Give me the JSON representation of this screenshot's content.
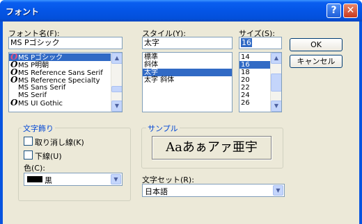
{
  "window": {
    "title": "フォント"
  },
  "titlebar_buttons": {
    "help": "?",
    "close": "✕"
  },
  "font_name": {
    "label": "フォント名(F):",
    "value": "MS Pゴシック",
    "items": [
      {
        "glyph": "O",
        "label": "MS Pゴシック",
        "selected": true
      },
      {
        "glyph": "O",
        "label": "MS P明朝",
        "selected": false
      },
      {
        "glyph": "O",
        "label": "MS Reference Sans Serif",
        "selected": false
      },
      {
        "glyph": "O",
        "label": "MS Reference Specialty",
        "selected": false
      },
      {
        "glyph": "",
        "label": "MS Sans Serif",
        "selected": false
      },
      {
        "glyph": "",
        "label": "MS Serif",
        "selected": false
      },
      {
        "glyph": "O",
        "label": "MS UI Gothic",
        "selected": false
      }
    ]
  },
  "style": {
    "label": "スタイル(Y):",
    "value": "太字",
    "items": [
      {
        "label": "標準",
        "selected": false
      },
      {
        "label": "斜体",
        "selected": false
      },
      {
        "label": "太字",
        "selected": true
      },
      {
        "label": "太字 斜体",
        "selected": false
      }
    ]
  },
  "size": {
    "label": "サイズ(S):",
    "value": "16",
    "items": [
      {
        "label": "14",
        "selected": false
      },
      {
        "label": "16",
        "selected": true
      },
      {
        "label": "18",
        "selected": false
      },
      {
        "label": "20",
        "selected": false
      },
      {
        "label": "22",
        "selected": false
      },
      {
        "label": "24",
        "selected": false
      },
      {
        "label": "26",
        "selected": false
      }
    ]
  },
  "buttons": {
    "ok": "OK",
    "cancel": "キャンセル"
  },
  "effects": {
    "title": "文字飾り",
    "strikeout": {
      "label": "取り消し線(K)",
      "checked": false
    },
    "underline": {
      "label": "下線(U)",
      "checked": false
    },
    "color_label": "色(C):",
    "color_value": "黒",
    "color_swatch": "#000000"
  },
  "sample": {
    "title": "サンプル",
    "text": "Aaあぁアァ亜宇"
  },
  "script": {
    "label": "文字セット(R):",
    "value": "日本語"
  },
  "colors": {
    "accent": "#0046d5",
    "selection": "#316ac5",
    "face": "#ece9d8"
  }
}
